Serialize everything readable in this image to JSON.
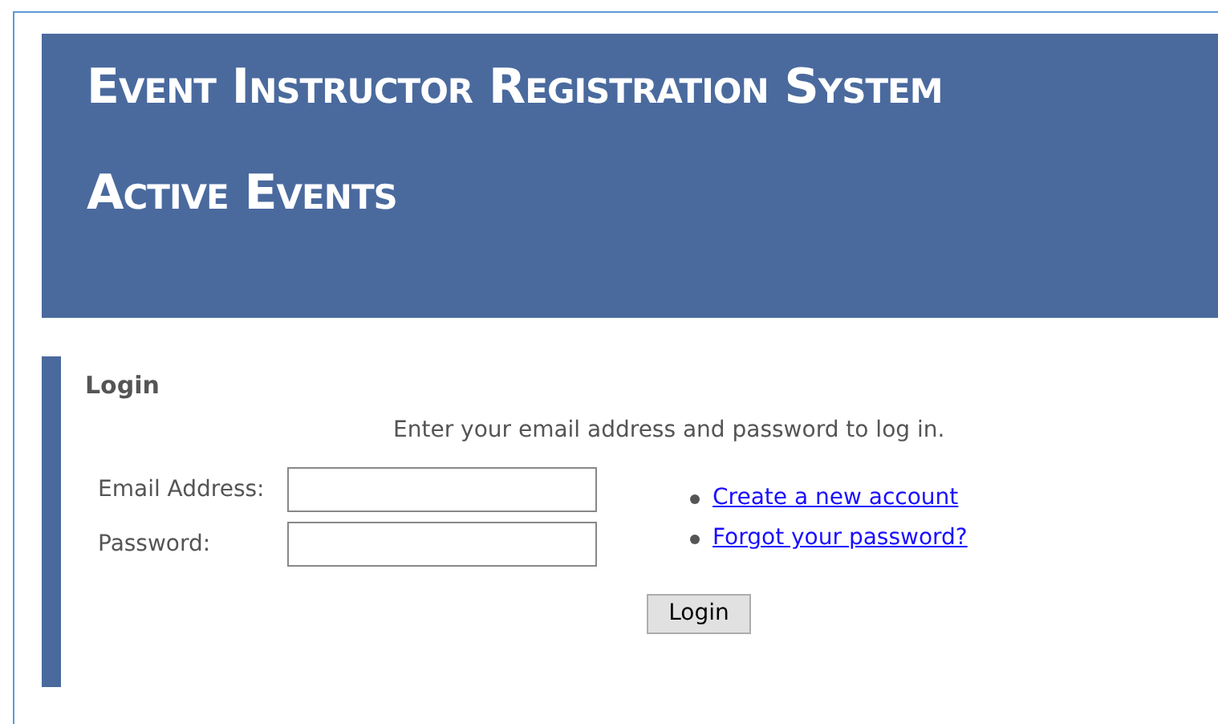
{
  "header": {
    "title": "Event Instructor Registration System",
    "subtitle": "Active Events"
  },
  "login": {
    "heading": "Login",
    "instructions": "Enter your email address and password to log in.",
    "fields": [
      {
        "label": "Email Address:"
      },
      {
        "label": "Password:"
      }
    ],
    "links": [
      "Create a new account",
      "Forgot your password?"
    ],
    "button": "Login"
  }
}
